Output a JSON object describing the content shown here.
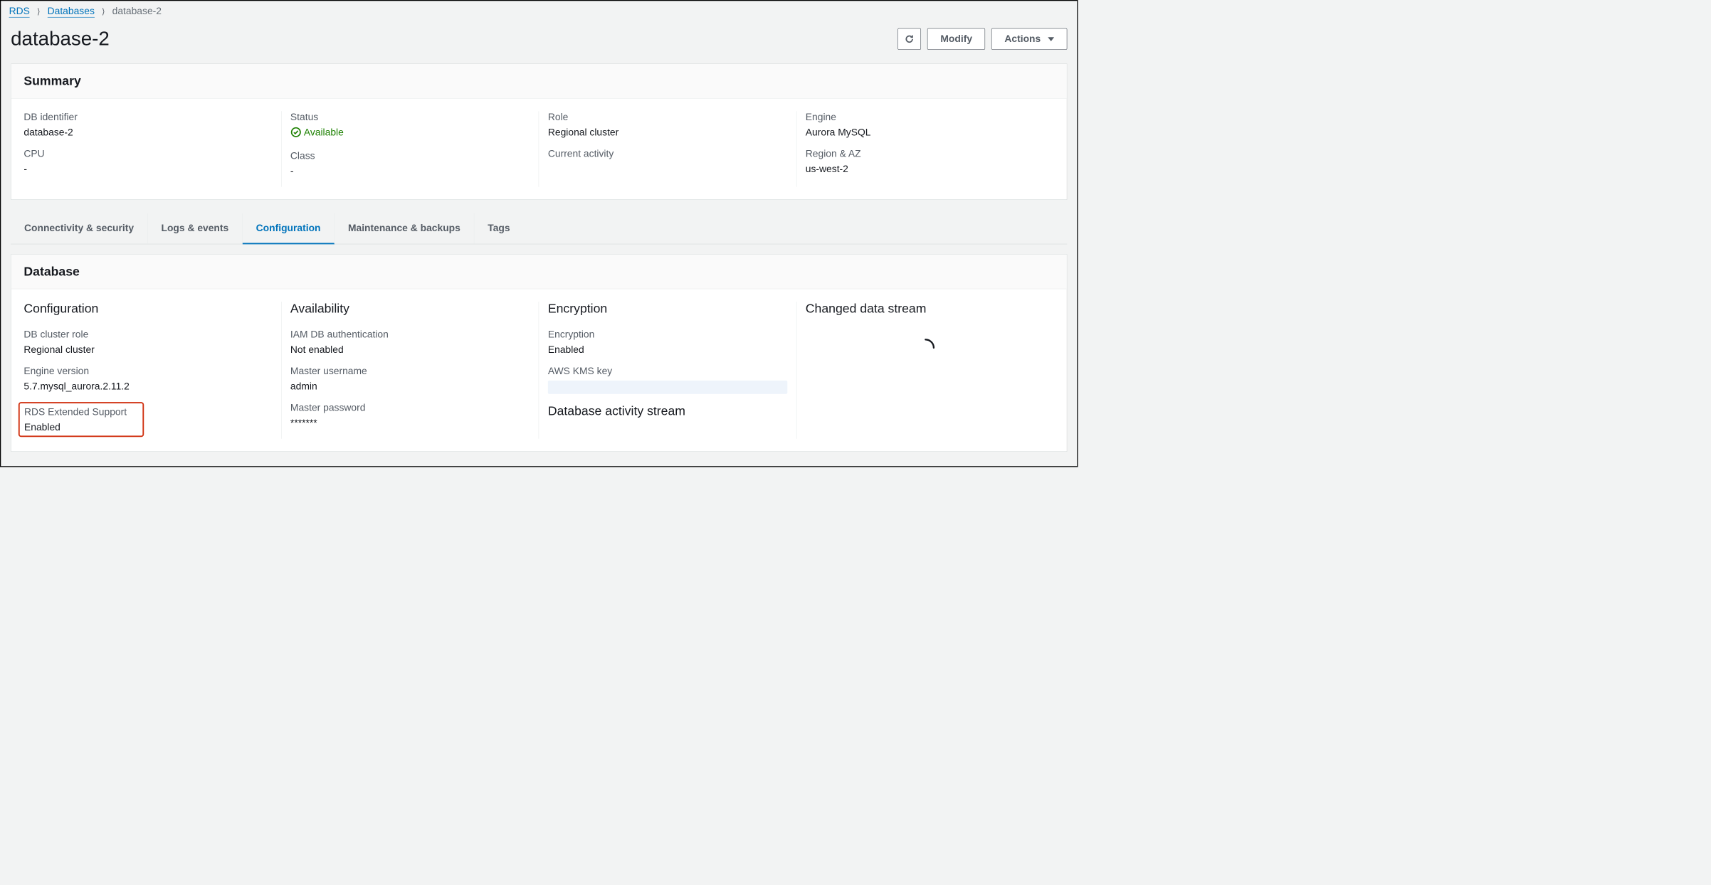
{
  "breadcrumb": {
    "root": "RDS",
    "parent": "Databases",
    "current": "database-2"
  },
  "header": {
    "title": "database-2",
    "refresh_aria": "Refresh",
    "modify_label": "Modify",
    "actions_label": "Actions"
  },
  "summary": {
    "title": "Summary",
    "db_identifier_label": "DB identifier",
    "db_identifier_value": "database-2",
    "cpu_label": "CPU",
    "cpu_value": "-",
    "status_label": "Status",
    "status_value": "Available",
    "class_label": "Class",
    "class_value": "-",
    "role_label": "Role",
    "role_value": "Regional cluster",
    "current_activity_label": "Current activity",
    "engine_label": "Engine",
    "engine_value": "Aurora MySQL",
    "region_az_label": "Region & AZ",
    "region_az_value": "us-west-2"
  },
  "tabs": {
    "connectivity": "Connectivity & security",
    "logs": "Logs & events",
    "configuration": "Configuration",
    "maintenance": "Maintenance & backups",
    "tags": "Tags"
  },
  "database_panel": {
    "title": "Database",
    "configuration": {
      "section_title": "Configuration",
      "db_cluster_role_label": "DB cluster role",
      "db_cluster_role_value": "Regional cluster",
      "engine_version_label": "Engine version",
      "engine_version_value": "5.7.mysql_aurora.2.11.2",
      "rds_extended_support_label": "RDS Extended Support",
      "rds_extended_support_value": "Enabled"
    },
    "availability": {
      "section_title": "Availability",
      "iam_db_auth_label": "IAM DB authentication",
      "iam_db_auth_value": "Not enabled",
      "master_username_label": "Master username",
      "master_username_value": "admin",
      "master_password_label": "Master password",
      "master_password_value": "*******"
    },
    "encryption": {
      "section_title": "Encryption",
      "encryption_label": "Encryption",
      "encryption_value": "Enabled",
      "aws_kms_key_label": "AWS KMS key",
      "das_title": "Database activity stream"
    },
    "changed_data_stream": {
      "section_title": "Changed data stream"
    }
  }
}
